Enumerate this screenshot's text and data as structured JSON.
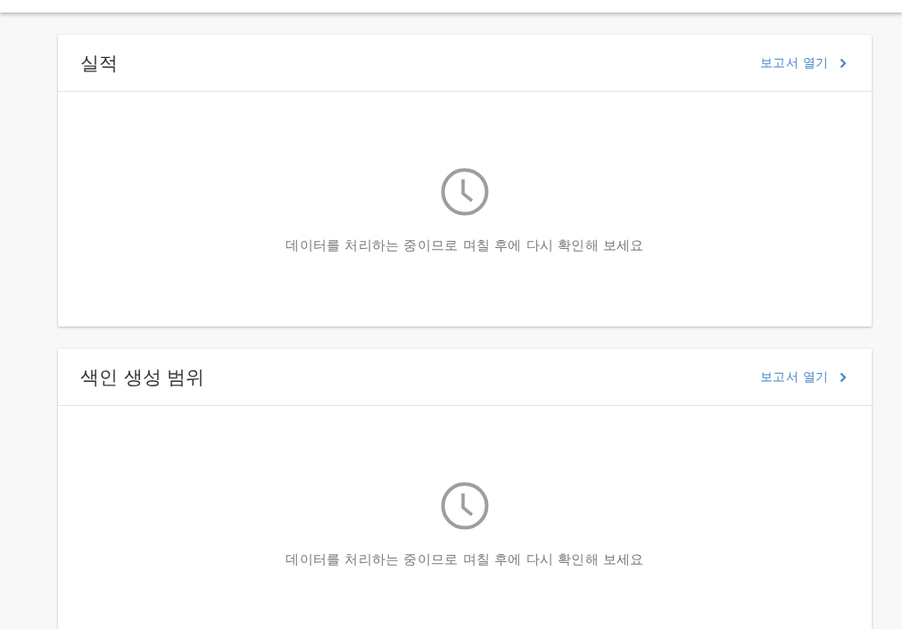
{
  "cards": [
    {
      "title": "실적",
      "link": "보고서 열기",
      "message": "데이터를 처리하는 중이므로 며칠 후에 다시 확인해 보세요"
    },
    {
      "title": "색인 생성 범위",
      "link": "보고서 열기",
      "message": "데이터를 처리하는 중이므로 며칠 후에 다시 확인해 보세요"
    }
  ]
}
